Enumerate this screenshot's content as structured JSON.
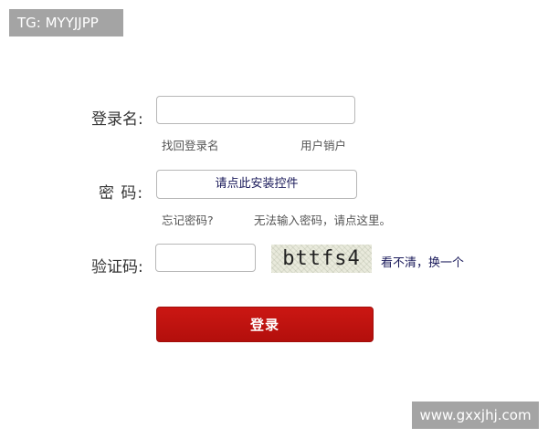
{
  "top_tag": {
    "text": "TG: MYYJJPP"
  },
  "form": {
    "username": {
      "label": "登录名:",
      "value": "",
      "placeholder": "",
      "links": {
        "find_name": "找回登录名",
        "cancel_user": "用户销户"
      }
    },
    "password": {
      "label": "密  码:",
      "plugin_prompt": "请点此安装控件",
      "links": {
        "forgot": "忘记密码?",
        "cannot_input": "无法输入密码，请点这里。"
      }
    },
    "captcha": {
      "label": "验证码:",
      "value": "",
      "placeholder": "",
      "image_text": "bttfs4",
      "refresh_link": "看不清，换一个"
    },
    "submit_label": "登录"
  },
  "watermark": {
    "text": "www.gxxjhj.com"
  },
  "colors": {
    "primary_button": "#c0120f",
    "link_dark": "#1a1a5a",
    "badge_gray": "#a4a4a4"
  }
}
